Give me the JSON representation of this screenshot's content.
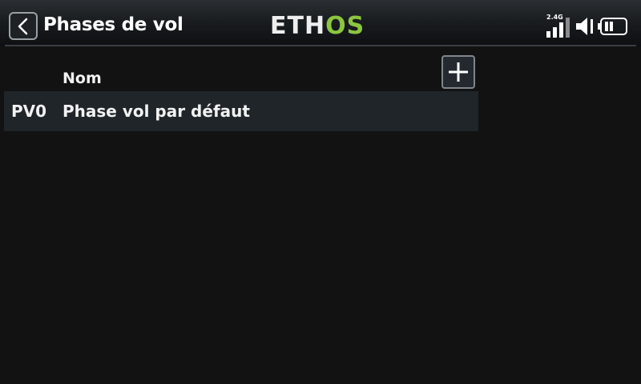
{
  "header": {
    "title": "Phases de vol",
    "logo_left": "ETH",
    "logo_right": "OS",
    "rf_band": "2.4G",
    "back_icon": "chevron-left-icon",
    "signal_icon": "signal-bars-icon",
    "volume_icon": "speaker-icon",
    "battery_icon": "battery-icon"
  },
  "table": {
    "column_name": "Nom",
    "add_icon": "plus-icon",
    "rows": [
      {
        "id": "PV0",
        "name": "Phase vol par défaut"
      }
    ]
  },
  "colors": {
    "background": "#121212",
    "row_background": "#1f2529",
    "logo_accent": "#8cc63f"
  }
}
